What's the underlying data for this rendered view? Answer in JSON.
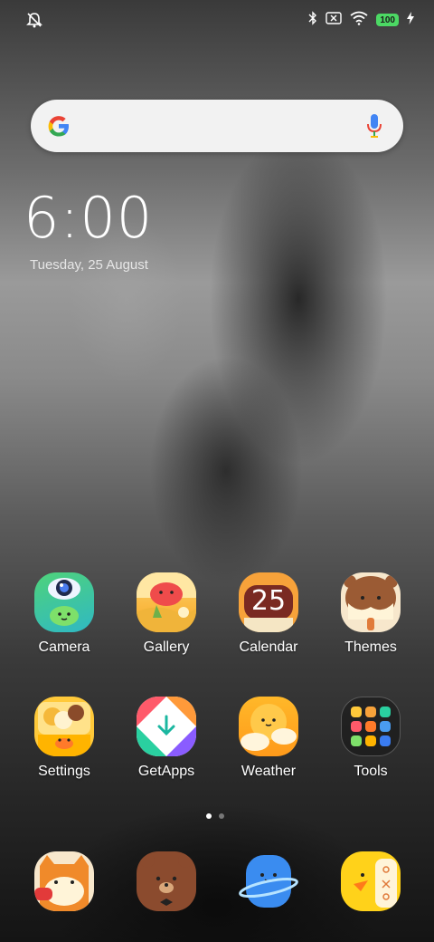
{
  "status_bar": {
    "left_icon": "alarm-off-icon",
    "right_icons": [
      "bluetooth-icon",
      "no-sim-icon",
      "wifi-icon"
    ],
    "battery_level": "100",
    "charging_icon": "bolt-icon"
  },
  "search": {
    "left_icon": "google-g-icon",
    "right_icon": "mic-icon"
  },
  "clock": {
    "time": "6:00",
    "date": "Tuesday, 25 August"
  },
  "apps": [
    {
      "label": "Camera"
    },
    {
      "label": "Gallery"
    },
    {
      "label": "Calendar",
      "badge": "25"
    },
    {
      "label": "Themes"
    },
    {
      "label": "Settings"
    },
    {
      "label": "GetApps"
    },
    {
      "label": "Weather"
    },
    {
      "label": "Tools"
    }
  ],
  "page_indicator": {
    "pages": 2,
    "current": 1
  },
  "dock": [
    {
      "icon": "phone-dialer-icon"
    },
    {
      "icon": "messages-bear-icon"
    },
    {
      "icon": "browser-planet-icon"
    },
    {
      "icon": "security-duck-icon"
    }
  ]
}
